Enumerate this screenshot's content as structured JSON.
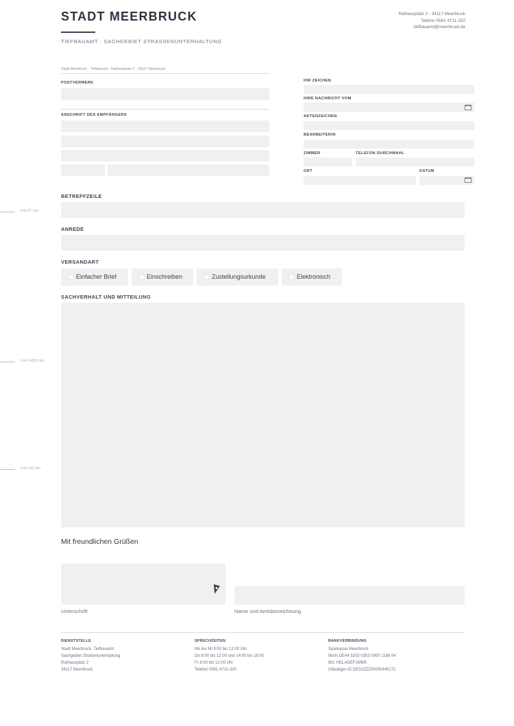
{
  "header": {
    "title": "STADT MEERBRUCK",
    "subtitle": "TIEFBAUAMT · SACHGEBIET STRASSENUNTERHALTUNG",
    "contact": [
      "Rathausplatz 2 · 34117 Meerbruck",
      "Telefon 0561 4711-320",
      "tiefbauamt@meerbruck.de"
    ]
  },
  "sender_line": "Stadt Meerbruck · Tiefbauamt · Rathausplatz 2 · 34117 Meerbruck",
  "recipient": {
    "postvermerk_label": "POSTVERMERK",
    "address_label": "ANSCHRIFT DES EMPFÄNGERS"
  },
  "info_block": {
    "ihr_zeichen": "IHR ZEICHEN",
    "ihre_nachricht": "IHRE NACHRICHT VOM",
    "aktenzeichen": "AKTENZEICHEN",
    "bearbeiterin": "BEARBEITERIN",
    "zimmer": "ZIMMER",
    "telefon": "TELEFON DURCHWAHL",
    "ort": "ORT",
    "datum": "DATUM"
  },
  "margin_marks": [
    "Falz 87 mm",
    "Loch 148,5 mm",
    "Falz 192 mm"
  ],
  "sections": {
    "betreff": "BETREFFZEILE",
    "anrede": "ANREDE",
    "versandart": "VERSANDART",
    "sachverhalt": "SACHVERHALT UND MITTEILUNG"
  },
  "versandart_options": [
    "Einfacher Brief",
    "Einschreiben",
    "Zustellungsurkunde",
    "Elektronisch"
  ],
  "closing": "Mit freundlichen Grüßen",
  "signature": {
    "label": "Unterschrift",
    "name_label": "Name und Amtsbezeichnung",
    "icon": "pen-nib-icon"
  },
  "footer": {
    "dienststelle": {
      "title": "DIENSTSTELLE",
      "lines": [
        "Stadt Meerbruck, Tiefbauamt",
        "Sachgebiet Straßenunterhaltung",
        "Rathausplatz 2",
        "34117 Meerbruck"
      ]
    },
    "sprechzeiten": {
      "title": "SPRECHZEITEN",
      "lines": [
        "Mo bis Mi 8:00 bis 12:00 Uhr",
        "Do 8:00 bis 12:00 und 14:00 bis 18:00",
        "Fr 8:00 bis 12:00 Uhr",
        "Telefon 0561 4711-320"
      ]
    },
    "bank": {
      "title": "BANKVERBINDUNG",
      "lines": [
        "Sparkasse Meerbruck",
        "IBAN DE44 5205 0353 0000 1188 04",
        "BIC HELADEF1MBR",
        "Gläubiger-ID DE31ZZZ00000445172"
      ]
    }
  },
  "colors": {
    "accent": "#3b4252",
    "field": "#f0f0f0",
    "text": "#2e3440"
  }
}
